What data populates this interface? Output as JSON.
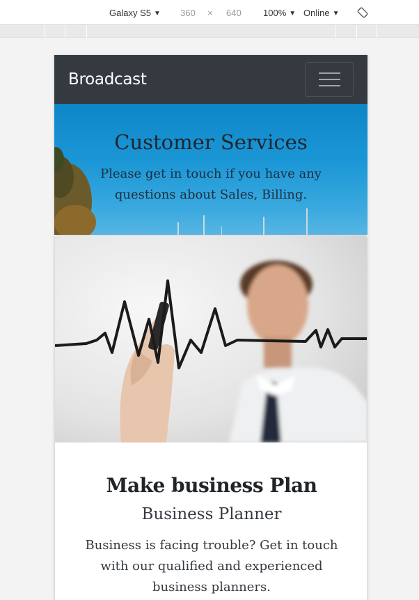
{
  "devtools": {
    "device": "Galaxy S5",
    "width": "360",
    "times": "×",
    "height": "640",
    "zoom": "100%",
    "network": "Online",
    "rotate_icon": "rotate-icon"
  },
  "navbar": {
    "brand": "Broadcast",
    "toggler_icon": "hamburger-menu-icon"
  },
  "hero": {
    "title": "Customer Services",
    "text": "Please get in touch if you have any questions about Sales, Billing."
  },
  "card": {
    "image": "businessman-drawing-heartbeat-line",
    "title": "Make business Plan",
    "subtitle": "Business Planner",
    "text": "Business is facing trouble? Get in touch with our qualified and experienced business planners."
  },
  "colors": {
    "navbar_bg": "#343a40",
    "hero_sky": "#1c97d6",
    "text_dark": "#212529"
  }
}
